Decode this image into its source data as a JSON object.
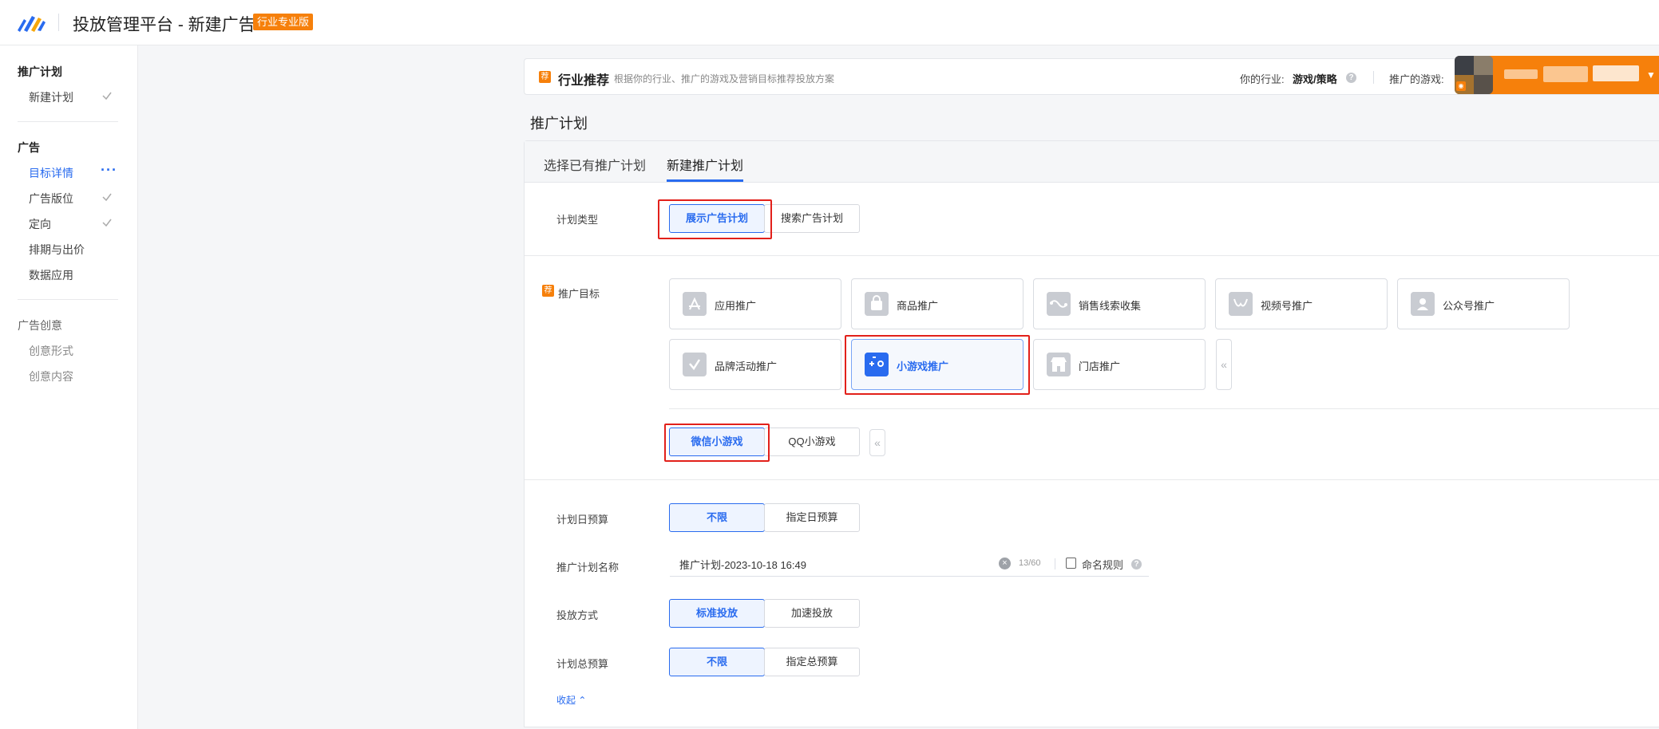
{
  "header": {
    "title": "投放管理平台 - 新建广告",
    "badge": "行业专业版"
  },
  "sidebar": {
    "sections": [
      {
        "title": "推广计划",
        "items": [
          {
            "label": "新建计划",
            "state": "done"
          }
        ]
      },
      {
        "title": "广告",
        "items": [
          {
            "label": "目标详情",
            "state": "active"
          },
          {
            "label": "广告版位",
            "state": "done"
          },
          {
            "label": "定向",
            "state": "done"
          },
          {
            "label": "排期与出价",
            "state": "pending"
          },
          {
            "label": "数据应用",
            "state": "pending"
          }
        ]
      },
      {
        "title": "广告创意",
        "items": [
          {
            "label": "创意形式",
            "state": "disabled"
          },
          {
            "label": "创意内容",
            "state": "disabled"
          }
        ]
      }
    ]
  },
  "recommend": {
    "icon_text": "荐",
    "title": "行业推荐",
    "desc": "根据你的行业、推广的游戏及营销目标推荐投放方案",
    "industry_label": "你的行业:",
    "industry_value": "游戏/策略",
    "game_label": "推广的游戏:"
  },
  "section_title": "推广计划",
  "tabs": [
    {
      "label": "选择已有推广计划",
      "active": false
    },
    {
      "label": "新建推广计划",
      "active": true
    }
  ],
  "plan_type": {
    "label": "计划类型",
    "options": [
      "展示广告计划",
      "搜索广告计划"
    ],
    "selected": "展示广告计划"
  },
  "goal": {
    "icon_text": "荐",
    "label": "推广目标",
    "options": [
      {
        "label": "应用推广",
        "icon": "app-store-icon"
      },
      {
        "label": "商品推广",
        "icon": "shopping-bag-icon"
      },
      {
        "label": "销售线索收集",
        "icon": "leads-wave-icon"
      },
      {
        "label": "视频号推广",
        "icon": "channels-icon"
      },
      {
        "label": "公众号推广",
        "icon": "official-account-icon"
      },
      {
        "label": "品牌活动推广",
        "icon": "brand-check-icon"
      },
      {
        "label": "小游戏推广",
        "icon": "mini-game-icon",
        "selected": true
      },
      {
        "label": "门店推广",
        "icon": "store-icon"
      }
    ],
    "collapse_glyph": "«"
  },
  "sub_goal": {
    "options": [
      "微信小游戏",
      "QQ小游戏"
    ],
    "selected": "微信小游戏",
    "collapse_glyph": "«"
  },
  "daily_budget": {
    "label": "计划日预算",
    "options": [
      "不限",
      "指定日预算"
    ],
    "selected": "不限"
  },
  "plan_name": {
    "label": "推广计划名称",
    "value": "推广计划-2023-10-18 16:49",
    "counter": "13/60",
    "rule_label": "命名规则"
  },
  "delivery": {
    "label": "投放方式",
    "options": [
      "标准投放",
      "加速投放"
    ],
    "selected": "标准投放"
  },
  "total_budget": {
    "label": "计划总预算",
    "options": [
      "不限",
      "指定总预算"
    ],
    "selected": "不限"
  },
  "collapse_label": "收起 ⌃",
  "colors": {
    "accent": "#296bef",
    "brand_orange": "#f6800b",
    "highlight_red": "#e2201a"
  }
}
